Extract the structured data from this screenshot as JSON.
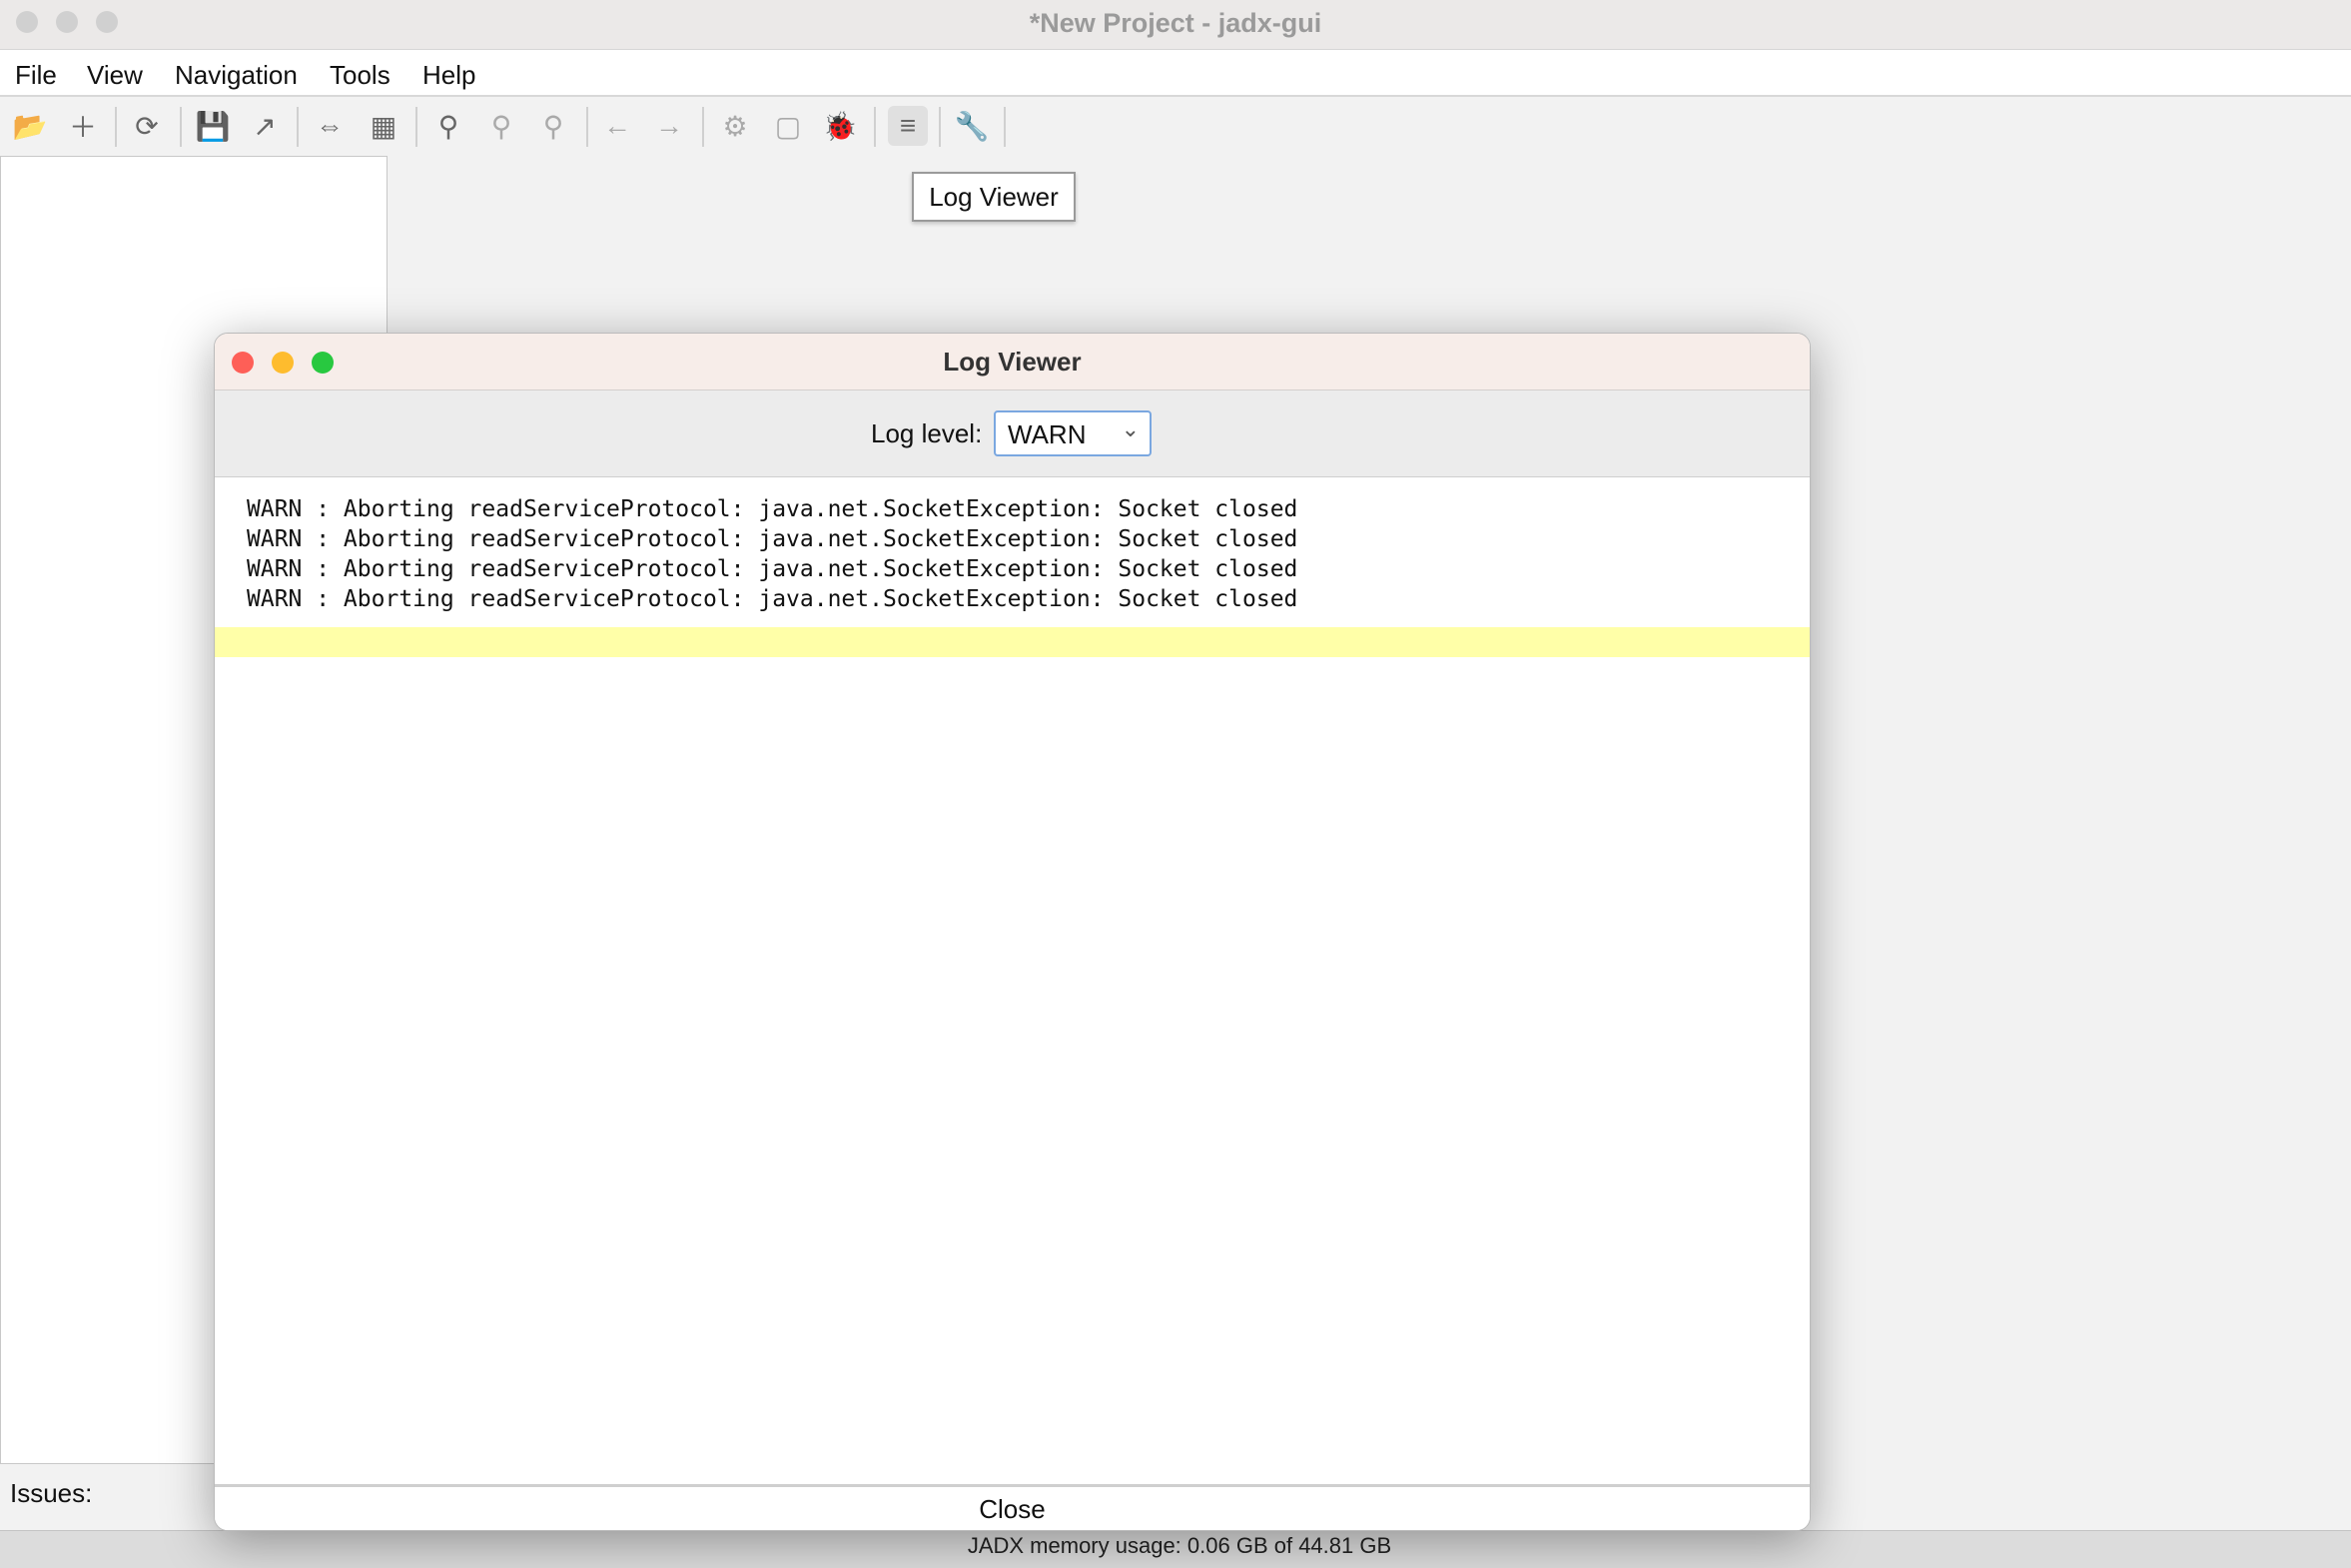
{
  "window": {
    "title": "*New Project - jadx-gui"
  },
  "menu": [
    "File",
    "View",
    "Navigation",
    "Tools",
    "Help"
  ],
  "toolbar": [
    {
      "icon": "open-folder-icon",
      "glyph": "📂"
    },
    {
      "icon": "add-file-icon",
      "glyph": "＋"
    },
    {
      "icon": "reload-icon",
      "glyph": "⟳"
    },
    {
      "icon": "save-icon",
      "glyph": "💾"
    },
    {
      "icon": "export-icon",
      "glyph": "↗"
    },
    {
      "icon": "sync-tree-icon",
      "glyph": "⇔"
    },
    {
      "icon": "flatten-packages-icon",
      "glyph": "▦"
    },
    {
      "icon": "search-icon",
      "glyph": "⚲"
    },
    {
      "icon": "find-class-icon",
      "glyph": "⚲"
    },
    {
      "icon": "find-usage-icon",
      "glyph": "⚲"
    },
    {
      "icon": "back-icon",
      "glyph": "←"
    },
    {
      "icon": "forward-icon",
      "glyph": "→"
    },
    {
      "icon": "deobfuscation-icon",
      "glyph": "⚙"
    },
    {
      "icon": "quark-icon",
      "glyph": "▢"
    },
    {
      "icon": "debugger-bug-icon",
      "glyph": "🐞"
    },
    {
      "icon": "log-viewer-icon",
      "glyph": "≡"
    },
    {
      "icon": "preferences-wrench-icon",
      "glyph": "🔧"
    }
  ],
  "tooltip": "Log Viewer",
  "issues_label": "Issues:",
  "status": {
    "memory": "JADX memory usage: 0.06 GB of 44.81 GB"
  },
  "dialog": {
    "title": "Log Viewer",
    "log_level_label": "Log level:",
    "log_level_value": "WARN",
    "lines": [
      "WARN : Aborting readServiceProtocol: java.net.SocketException: Socket closed",
      "WARN : Aborting readServiceProtocol: java.net.SocketException: Socket closed",
      "WARN : Aborting readServiceProtocol: java.net.SocketException: Socket closed",
      "WARN : Aborting readServiceProtocol: java.net.SocketException: Socket closed"
    ],
    "close_label": "Close"
  },
  "colors": {
    "traffic_red": "#fe5f57",
    "traffic_yellow": "#febc2e",
    "traffic_green": "#28c840",
    "highlight": "#ffffa8",
    "bug_green": "#4ca35a",
    "preview_blue": "#2da7e0"
  }
}
